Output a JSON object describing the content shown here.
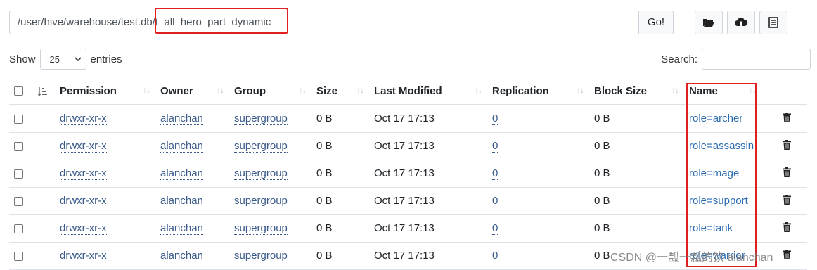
{
  "path_bar": {
    "value": "/user/hive/warehouse/test.db/t_all_hero_part_dynamic",
    "go_label": "Go!"
  },
  "toolbar": {
    "icons": [
      "folder-open-icon",
      "upload-cloud-icon",
      "list-icon"
    ]
  },
  "length": {
    "show_label": "Show",
    "selected": "25",
    "entries_label": "entries"
  },
  "search": {
    "label": "Search:",
    "value": ""
  },
  "table": {
    "columns": [
      "Permission",
      "Owner",
      "Group",
      "Size",
      "Last Modified",
      "Replication",
      "Block Size",
      "Name"
    ],
    "rows": [
      {
        "permission": "drwxr-xr-x",
        "owner": "alanchan",
        "group": "supergroup",
        "size": "0 B",
        "modified": "Oct 17 17:13",
        "replication": "0",
        "block_size": "0 B",
        "name": "role=archer"
      },
      {
        "permission": "drwxr-xr-x",
        "owner": "alanchan",
        "group": "supergroup",
        "size": "0 B",
        "modified": "Oct 17 17:13",
        "replication": "0",
        "block_size": "0 B",
        "name": "role=assassin"
      },
      {
        "permission": "drwxr-xr-x",
        "owner": "alanchan",
        "group": "supergroup",
        "size": "0 B",
        "modified": "Oct 17 17:13",
        "replication": "0",
        "block_size": "0 B",
        "name": "role=mage"
      },
      {
        "permission": "drwxr-xr-x",
        "owner": "alanchan",
        "group": "supergroup",
        "size": "0 B",
        "modified": "Oct 17 17:13",
        "replication": "0",
        "block_size": "0 B",
        "name": "role=support"
      },
      {
        "permission": "drwxr-xr-x",
        "owner": "alanchan",
        "group": "supergroup",
        "size": "0 B",
        "modified": "Oct 17 17:13",
        "replication": "0",
        "block_size": "0 B",
        "name": "role=tank"
      },
      {
        "permission": "drwxr-xr-x",
        "owner": "alanchan",
        "group": "supergroup",
        "size": "0 B",
        "modified": "Oct 17 17:13",
        "replication": "0",
        "block_size": "0 B",
        "name": "role=warrior"
      }
    ]
  },
  "watermark": "CSDN @一瓢一瓢的饮 alanchan",
  "colors": {
    "highlight": "#e02020",
    "link": "#2b6cb0"
  }
}
